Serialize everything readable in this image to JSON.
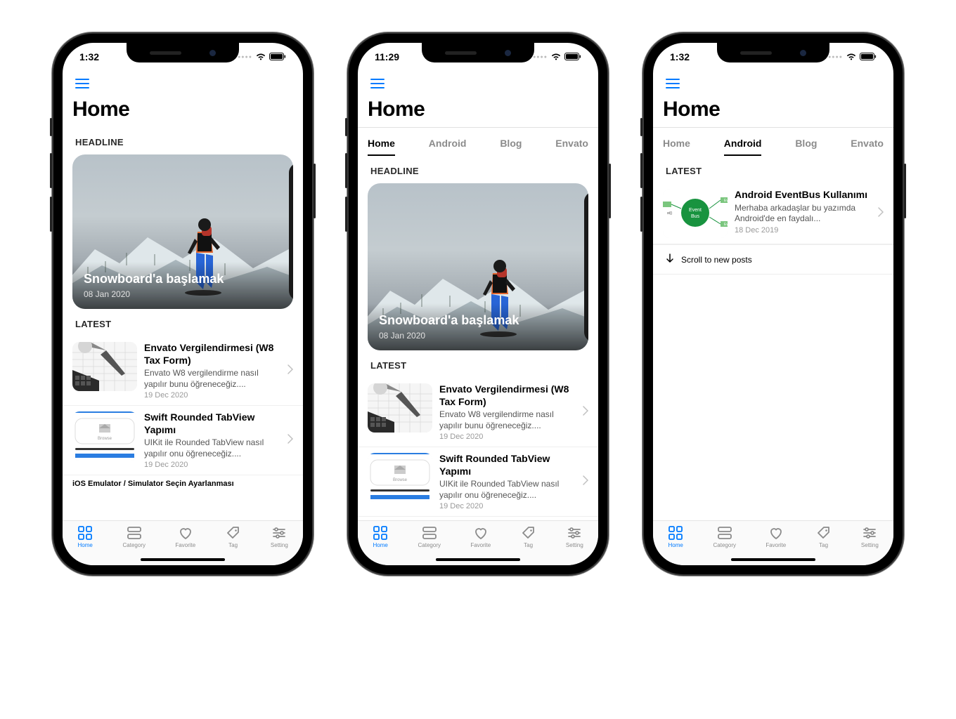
{
  "status": {
    "wifi": true,
    "battery": 100
  },
  "pageTitle": "Home",
  "segTabs": [
    "Home",
    "Android",
    "Blog",
    "Envato"
  ],
  "labels": {
    "headline": "HEADLINE",
    "latest": "LATEST"
  },
  "scrollHint": "Scroll to new posts",
  "cutoffText": "iOS Emulator / Simulator Seçin Ayarlanması",
  "headline": {
    "title": "Snowboard'a başlamak",
    "date": "08 Jan 2020"
  },
  "tabbar": [
    {
      "label": "Home",
      "icon": "grid",
      "active": true
    },
    {
      "label": "Category",
      "icon": "stack",
      "active": false
    },
    {
      "label": "Favorite",
      "icon": "heart",
      "active": false
    },
    {
      "label": "Tag",
      "icon": "tag",
      "active": false
    },
    {
      "label": "Setting",
      "icon": "sliders",
      "active": false
    }
  ],
  "latest": [
    {
      "title": "Envato Vergilendirmesi (W8 Tax Form)",
      "excerpt": "Envato W8 vergilendirme nasıl yapılır bunu öğreneceğiz....",
      "date": "19 Dec 2020",
      "thumb": "envato"
    },
    {
      "title": "Swift Rounded TabView Yapımı",
      "excerpt": "UIKit ile Rounded TabView nasıl yapılır onu öğreneceğiz....",
      "date": "19 Dec 2020",
      "thumb": "tabview"
    }
  ],
  "androidLatest": [
    {
      "title": "Android EventBus Kullanımı",
      "excerpt": "Merhaba arkadaşlar bu yazımda Android'de en faydalı...",
      "date": "18 Dec 2019",
      "thumb": "eventbus"
    }
  ],
  "screens": [
    {
      "time": "1:32",
      "showTabs": false,
      "activeSeg": "Home",
      "mode": "home-default"
    },
    {
      "time": "11:29",
      "showTabs": true,
      "activeSeg": "Home",
      "mode": "home-tabs"
    },
    {
      "time": "1:32",
      "showTabs": true,
      "activeSeg": "Android",
      "mode": "android"
    }
  ]
}
